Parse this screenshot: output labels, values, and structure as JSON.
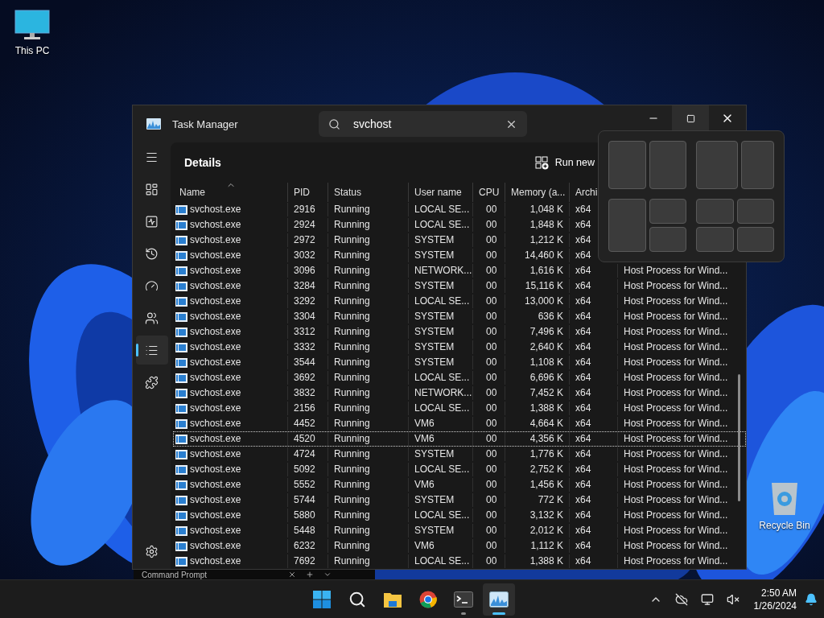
{
  "desktop": {
    "icons": [
      {
        "kind": "pc",
        "label": "This PC"
      },
      {
        "kind": "bin",
        "label": "Recycle Bin"
      }
    ]
  },
  "background_window": {
    "title": "Command Prompt"
  },
  "window": {
    "title": "Task Manager",
    "search": {
      "value": "svchost"
    },
    "caption_buttons": [
      {
        "kind": "minimize",
        "hovered": false
      },
      {
        "kind": "maximize",
        "hovered": true
      },
      {
        "kind": "close",
        "hovered": false
      }
    ]
  },
  "nav": [
    {
      "kind": "menu",
      "selected": false
    },
    {
      "kind": "processes",
      "selected": false
    },
    {
      "kind": "performance",
      "selected": false
    },
    {
      "kind": "history",
      "selected": false
    },
    {
      "kind": "startup",
      "selected": false
    },
    {
      "kind": "users",
      "selected": false
    },
    {
      "kind": "details",
      "selected": true
    },
    {
      "kind": "services",
      "selected": false
    }
  ],
  "nav_bottom": [
    {
      "kind": "settings",
      "selected": false
    }
  ],
  "page": {
    "title": "Details",
    "action": "Run new"
  },
  "table": {
    "columns": [
      {
        "label": "Name",
        "sorted": true
      },
      {
        "label": "PID",
        "sorted": false
      },
      {
        "label": "Status",
        "sorted": false
      },
      {
        "label": "User name",
        "sorted": false
      },
      {
        "label": "CPU",
        "sorted": false
      },
      {
        "label": "Memory (a...",
        "sorted": false
      },
      {
        "label": "Archi",
        "sorted": false
      }
    ],
    "rows": [
      {
        "name": "svchost.exe",
        "pid": "2916",
        "status": "Running",
        "user": "LOCAL SE...",
        "cpu": "00",
        "memory": "1,048 K",
        "arch": "x64",
        "selected": false
      },
      {
        "name": "svchost.exe",
        "pid": "2924",
        "status": "Running",
        "user": "LOCAL SE...",
        "cpu": "00",
        "memory": "1,848 K",
        "arch": "x64",
        "selected": false
      },
      {
        "name": "svchost.exe",
        "pid": "2972",
        "status": "Running",
        "user": "SYSTEM",
        "cpu": "00",
        "memory": "1,212 K",
        "arch": "x64",
        "selected": false
      },
      {
        "name": "svchost.exe",
        "pid": "3032",
        "status": "Running",
        "user": "SYSTEM",
        "cpu": "00",
        "memory": "14,460 K",
        "arch": "x64",
        "selected": false
      },
      {
        "name": "svchost.exe",
        "pid": "3096",
        "status": "Running",
        "user": "NETWORK...",
        "cpu": "00",
        "memory": "1,616 K",
        "arch": "x64",
        "description": "Host Process for Wind...",
        "selected": false
      },
      {
        "name": "svchost.exe",
        "pid": "3284",
        "status": "Running",
        "user": "SYSTEM",
        "cpu": "00",
        "memory": "15,116 K",
        "arch": "x64",
        "description": "Host Process for Wind...",
        "selected": false
      },
      {
        "name": "svchost.exe",
        "pid": "3292",
        "status": "Running",
        "user": "LOCAL SE...",
        "cpu": "00",
        "memory": "13,000 K",
        "arch": "x64",
        "description": "Host Process for Wind...",
        "selected": false
      },
      {
        "name": "svchost.exe",
        "pid": "3304",
        "status": "Running",
        "user": "SYSTEM",
        "cpu": "00",
        "memory": "636 K",
        "arch": "x64",
        "description": "Host Process for Wind...",
        "selected": false
      },
      {
        "name": "svchost.exe",
        "pid": "3312",
        "status": "Running",
        "user": "SYSTEM",
        "cpu": "00",
        "memory": "7,496 K",
        "arch": "x64",
        "description": "Host Process for Wind...",
        "selected": false
      },
      {
        "name": "svchost.exe",
        "pid": "3332",
        "status": "Running",
        "user": "SYSTEM",
        "cpu": "00",
        "memory": "2,640 K",
        "arch": "x64",
        "description": "Host Process for Wind...",
        "selected": false
      },
      {
        "name": "svchost.exe",
        "pid": "3544",
        "status": "Running",
        "user": "SYSTEM",
        "cpu": "00",
        "memory": "1,108 K",
        "arch": "x64",
        "description": "Host Process for Wind...",
        "selected": false
      },
      {
        "name": "svchost.exe",
        "pid": "3692",
        "status": "Running",
        "user": "LOCAL SE...",
        "cpu": "00",
        "memory": "6,696 K",
        "arch": "x64",
        "description": "Host Process for Wind...",
        "selected": false
      },
      {
        "name": "svchost.exe",
        "pid": "3832",
        "status": "Running",
        "user": "NETWORK...",
        "cpu": "00",
        "memory": "7,452 K",
        "arch": "x64",
        "description": "Host Process for Wind...",
        "selected": false
      },
      {
        "name": "svchost.exe",
        "pid": "2156",
        "status": "Running",
        "user": "LOCAL SE...",
        "cpu": "00",
        "memory": "1,388 K",
        "arch": "x64",
        "description": "Host Process for Wind...",
        "selected": false
      },
      {
        "name": "svchost.exe",
        "pid": "4452",
        "status": "Running",
        "user": "VM6",
        "cpu": "00",
        "memory": "4,664 K",
        "arch": "x64",
        "description": "Host Process for Wind...",
        "selected": false
      },
      {
        "name": "svchost.exe",
        "pid": "4520",
        "status": "Running",
        "user": "VM6",
        "cpu": "00",
        "memory": "4,356 K",
        "arch": "x64",
        "description": "Host Process for Wind...",
        "selected": true
      },
      {
        "name": "svchost.exe",
        "pid": "4724",
        "status": "Running",
        "user": "SYSTEM",
        "cpu": "00",
        "memory": "1,776 K",
        "arch": "x64",
        "description": "Host Process for Wind...",
        "selected": false
      },
      {
        "name": "svchost.exe",
        "pid": "5092",
        "status": "Running",
        "user": "LOCAL SE...",
        "cpu": "00",
        "memory": "2,752 K",
        "arch": "x64",
        "description": "Host Process for Wind...",
        "selected": false
      },
      {
        "name": "svchost.exe",
        "pid": "5552",
        "status": "Running",
        "user": "VM6",
        "cpu": "00",
        "memory": "1,456 K",
        "arch": "x64",
        "description": "Host Process for Wind...",
        "selected": false
      },
      {
        "name": "svchost.exe",
        "pid": "5744",
        "status": "Running",
        "user": "SYSTEM",
        "cpu": "00",
        "memory": "772 K",
        "arch": "x64",
        "description": "Host Process for Wind...",
        "selected": false
      },
      {
        "name": "svchost.exe",
        "pid": "5880",
        "status": "Running",
        "user": "LOCAL SE...",
        "cpu": "00",
        "memory": "3,132 K",
        "arch": "x64",
        "description": "Host Process for Wind...",
        "selected": false
      },
      {
        "name": "svchost.exe",
        "pid": "5448",
        "status": "Running",
        "user": "SYSTEM",
        "cpu": "00",
        "memory": "2,012 K",
        "arch": "x64",
        "description": "Host Process for Wind...",
        "selected": false
      },
      {
        "name": "svchost.exe",
        "pid": "6232",
        "status": "Running",
        "user": "VM6",
        "cpu": "00",
        "memory": "1,112 K",
        "arch": "x64",
        "description": "Host Process for Wind...",
        "selected": false
      },
      {
        "name": "svchost.exe",
        "pid": "7692",
        "status": "Running",
        "user": "LOCAL SE...",
        "cpu": "00",
        "memory": "1,388 K",
        "arch": "x64",
        "description": "Host Process for Wind...",
        "selected": false
      }
    ]
  },
  "taskbar": {
    "apps": [
      {
        "kind": "start",
        "running": false,
        "selected": false
      },
      {
        "kind": "search",
        "running": false,
        "selected": false
      },
      {
        "kind": "files",
        "running": false,
        "selected": false
      },
      {
        "kind": "browser",
        "running": false,
        "selected": false
      },
      {
        "kind": "terminal",
        "running": true,
        "selected": false
      },
      {
        "kind": "taskmanager",
        "running": true,
        "selected": true
      }
    ],
    "tray": [
      {
        "kind": "chevron"
      },
      {
        "kind": "cloud_off"
      },
      {
        "kind": "network"
      },
      {
        "kind": "volume_muted"
      }
    ],
    "time": "2:50 AM",
    "date": "1/26/2024"
  }
}
